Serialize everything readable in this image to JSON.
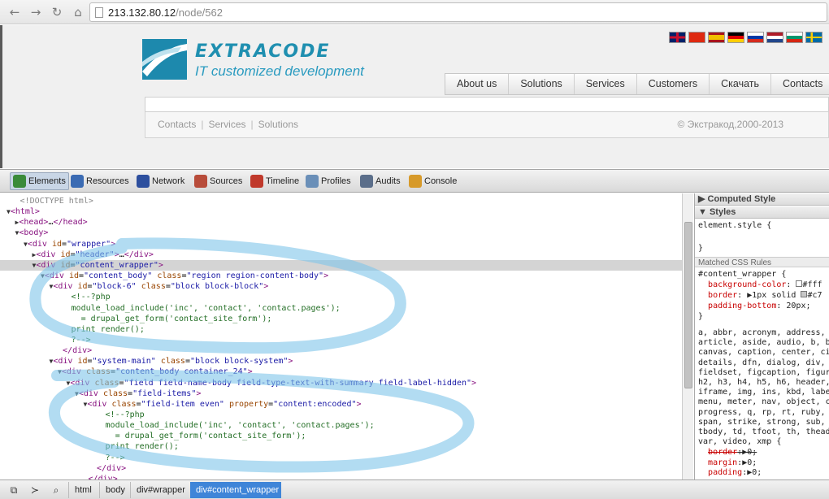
{
  "browser": {
    "url_host": "213.132.80.12",
    "url_path": "/node/562"
  },
  "site": {
    "brand": "EXTRACODE",
    "tagline": "IT customized development",
    "flags": [
      "gb",
      "cn",
      "es",
      "de",
      "ru",
      "nl",
      "bg",
      "se"
    ],
    "menu": [
      "About us",
      "Solutions",
      "Services",
      "Customers",
      "Скачать",
      "Contacts"
    ],
    "footer_links": [
      "Contacts",
      "Services",
      "Solutions"
    ],
    "copyright": "© Экстракод,2000-2013"
  },
  "devtools": {
    "tabs": [
      {
        "label": "Elements",
        "icon": "elements-icon",
        "color": "#3a8b3a"
      },
      {
        "label": "Resources",
        "icon": "resources-icon",
        "color": "#3b6bb3"
      },
      {
        "label": "Network",
        "icon": "network-icon",
        "color": "#2d4f9e"
      },
      {
        "label": "Sources",
        "icon": "sources-icon",
        "color": "#b84c3a"
      },
      {
        "label": "Timeline",
        "icon": "timeline-icon",
        "color": "#c0392b"
      },
      {
        "label": "Profiles",
        "icon": "profiles-icon",
        "color": "#6a8fb8"
      },
      {
        "label": "Audits",
        "icon": "audits-icon",
        "color": "#5b6e8a"
      },
      {
        "label": "Console",
        "icon": "console-icon",
        "color": "#d79a2a"
      }
    ],
    "dom_lines": [
      {
        "indent": 1,
        "tri": "",
        "html": "<span class=\"dt\">&lt;!DOCTYPE html&gt;</span>"
      },
      {
        "indent": 0,
        "tri": "▼",
        "html": "<span class=\"tg\">&lt;html&gt;</span>"
      },
      {
        "indent": 1,
        "tri": "▶",
        "html": "<span class=\"tg\">&lt;head&gt;</span>…<span class=\"tg\">&lt;/head&gt;</span>"
      },
      {
        "indent": 1,
        "tri": "▼",
        "html": "<span class=\"tg\">&lt;body&gt;</span>"
      },
      {
        "indent": 2,
        "tri": "▼",
        "html": "<span class=\"tg\">&lt;div </span><span class=\"an\">id</span>=<span class=\"av\">\"wrapper\"</span><span class=\"tg\">&gt;</span>"
      },
      {
        "indent": 3,
        "tri": "▶",
        "html": "<span class=\"tg\">&lt;div </span><span class=\"an\">id</span>=<span class=\"av\">\"header\"</span><span class=\"tg\">&gt;</span>…<span class=\"tg\">&lt;/div&gt;</span>"
      },
      {
        "indent": 3,
        "tri": "▼",
        "html": "<span class=\"tg\">&lt;div </span><span class=\"an\">id</span>=<span class=\"av\">\"content_wrapper\"</span><span class=\"tg\">&gt;</span>",
        "selected": true
      },
      {
        "indent": 4,
        "tri": "▼",
        "html": "<span class=\"tg\">&lt;div </span><span class=\"an\">id</span>=<span class=\"av\">\"content_body\"</span> <span class=\"an\">class</span>=<span class=\"av\">\"region region-content-body\"</span><span class=\"tg\">&gt;</span>"
      },
      {
        "indent": 5,
        "tri": "▼",
        "html": "<span class=\"tg\">&lt;div </span><span class=\"an\">id</span>=<span class=\"av\">\"block-6\"</span> <span class=\"an\">class</span>=<span class=\"av\">\"block block-block\"</span><span class=\"tg\">&gt;</span>"
      },
      {
        "indent": 7,
        "tri": "",
        "html": "<span class=\"cm\">&lt;!--?php</span>"
      },
      {
        "indent": 7,
        "tri": "",
        "html": "<span class=\"cm\">module_load_include('inc', 'contact', 'contact.pages');</span>"
      },
      {
        "indent": 7,
        "tri": "",
        "html": "<span class=\"cm\">  = drupal_get_form('contact_site_form');</span>"
      },
      {
        "indent": 7,
        "tri": "",
        "html": "<span class=\"cm\">print render();</span>"
      },
      {
        "indent": 7,
        "tri": "",
        "html": "<span class=\"cm\">?--&gt;</span>"
      },
      {
        "indent": 6,
        "tri": "",
        "html": "<span class=\"tg\">&lt;/div&gt;</span>"
      },
      {
        "indent": 5,
        "tri": "▼",
        "html": "<span class=\"tg\">&lt;div </span><span class=\"an\">id</span>=<span class=\"av\">\"system-main\"</span> <span class=\"an\">class</span>=<span class=\"av\">\"block block-system\"</span><span class=\"tg\">&gt;</span>"
      },
      {
        "indent": 6,
        "tri": "▼",
        "html": "<span class=\"tg\">&lt;div </span><span class=\"an\">class</span>=<span class=\"av\">\"content_body container_24\"</span><span class=\"tg\">&gt;</span>"
      },
      {
        "indent": 7,
        "tri": "▼",
        "html": "<span class=\"tg\">&lt;div </span><span class=\"an\">class</span>=<span class=\"av\">\"field field-name-body field-type-text-with-summary field-label-hidden\"</span><span class=\"tg\">&gt;</span>"
      },
      {
        "indent": 8,
        "tri": "▼",
        "html": "<span class=\"tg\">&lt;div </span><span class=\"an\">class</span>=<span class=\"av\">\"field-items\"</span><span class=\"tg\">&gt;</span>"
      },
      {
        "indent": 9,
        "tri": "▼",
        "html": "<span class=\"tg\">&lt;div </span><span class=\"an\">class</span>=<span class=\"av\">\"field-item even\"</span> <span class=\"an\">property</span>=<span class=\"av\">\"content:encoded\"</span><span class=\"tg\">&gt;</span>"
      },
      {
        "indent": 11,
        "tri": "",
        "html": "<span class=\"cm\">&lt;!--?php</span>"
      },
      {
        "indent": 11,
        "tri": "",
        "html": "<span class=\"cm\">module_load_include('inc', 'contact', 'contact.pages');</span>"
      },
      {
        "indent": 11,
        "tri": "",
        "html": "<span class=\"cm\">  = drupal_get_form('contact_site_form');</span>"
      },
      {
        "indent": 11,
        "tri": "",
        "html": "<span class=\"cm\">print render();</span>"
      },
      {
        "indent": 11,
        "tri": "",
        "html": "<span class=\"cm\">?--&gt;</span>"
      },
      {
        "indent": 10,
        "tri": "",
        "html": "<span class=\"tg\">&lt;/div&gt;</span>"
      },
      {
        "indent": 9,
        "tri": "",
        "html": "<span class=\"tg\">&lt;/div&gt;</span>"
      }
    ],
    "styles": {
      "computed_header": "Computed Style",
      "styles_header": "Styles",
      "element_style": "element.style {",
      "element_style_close": "}",
      "matched_header": "Matched CSS Rules",
      "rule_selector": "#content_wrapper {",
      "rule_props": [
        {
          "name": "background-color",
          "value": "#fff",
          "swatch": "#ffffff"
        },
        {
          "name": "border",
          "value": "1px solid",
          "swatch": "#c7c7c7",
          "extra": "#c7"
        },
        {
          "name": "padding-bottom",
          "value": "20px;"
        }
      ],
      "rule_close": "}",
      "reset_selectors": [
        "a, abbr, acronym, address,",
        "article, aside, audio, b, b",
        "canvas, caption, center, ci",
        "details, dfn, dialog, div,",
        "fieldset, figcaption, figur",
        "h2, h3, h4, h5, h6, header,",
        "iframe, img, ins, kbd, labe",
        "menu, meter, nav, object, c",
        "progress, q, rp, rt, ruby,",
        "span, strike, strong, sub,",
        "tbody, td, tfoot, th, thead",
        "var, video, xmp {"
      ],
      "reset_props": [
        {
          "name": "border",
          "value": "0;",
          "strike": true
        },
        {
          "name": "margin",
          "value": "0;"
        },
        {
          "name": "padding",
          "value": "0;"
        }
      ]
    },
    "breadcrumbs": [
      "html",
      "body",
      "div#wrapper",
      "div#content_wrapper"
    ]
  }
}
